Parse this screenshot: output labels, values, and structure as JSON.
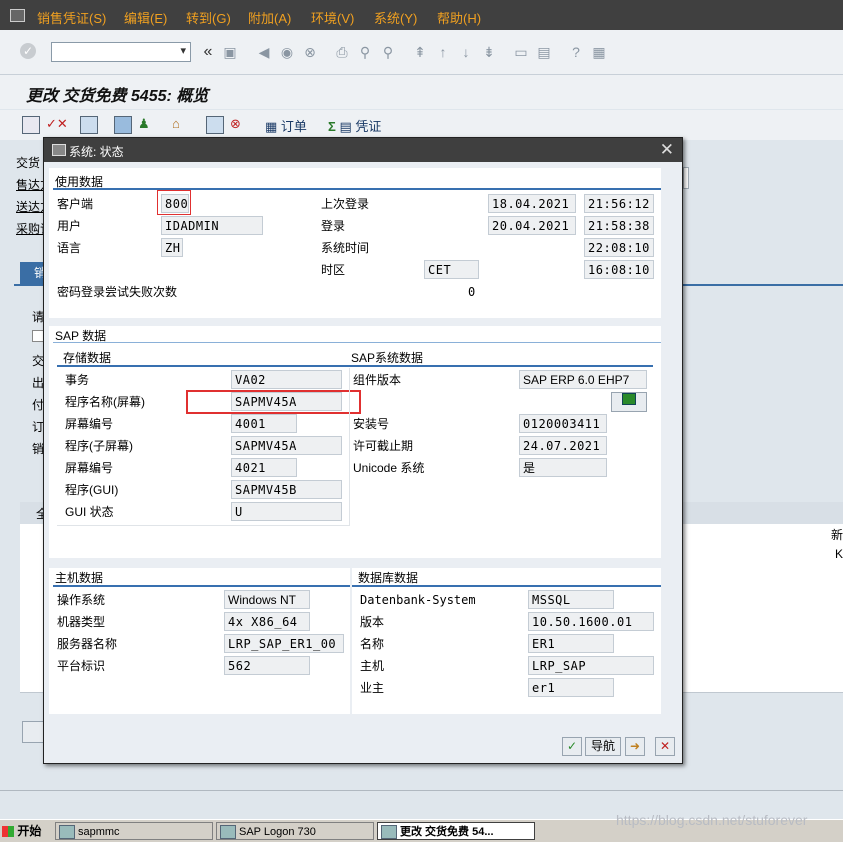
{
  "menu": {
    "items": [
      "销售凭证(S)",
      "编辑(E)",
      "转到(G)",
      "附加(A)",
      "环境(V)",
      "系统(Y)",
      "帮助(H)"
    ]
  },
  "toolbar": {
    "command_field": ""
  },
  "page": {
    "title": "更改 交货免费 5455: 概览"
  },
  "app_toolbar": {
    "order_label": "订单",
    "document_label": "凭证"
  },
  "background": {
    "labels": [
      "交货",
      "售达方",
      "送达方",
      "采购订"
    ],
    "tab_label": "销",
    "left_labels": [
      "请",
      "交",
      "出",
      "付",
      "订",
      "销"
    ],
    "table_header_left": "全",
    "right_fragment_1": "新",
    "right_fragment_2": "K"
  },
  "dialog": {
    "title": "系统: 状态",
    "usage": {
      "header": "使用数据",
      "client_label": "客户端",
      "client_value": "800",
      "user_label": "用户",
      "user_value": "IDADMIN",
      "language_label": "语言",
      "language_value": "ZH",
      "last_logon_label": "上次登录",
      "last_logon_date": "18.04.2021",
      "last_logon_time": "21:56:12",
      "logon_label": "登录",
      "logon_date": "20.04.2021",
      "logon_time": "21:58:38",
      "system_time_label": "系统时间",
      "system_time_value": "22:08:10",
      "timezone_label": "时区",
      "timezone_value": "CET",
      "timezone_time": "16:08:10",
      "failed_logon_label": "密码登录尝试失败次数",
      "failed_logon_value": "0"
    },
    "sap_data": {
      "header": "SAP 数据",
      "repository_header": "存储数据",
      "transaction_label": "事务",
      "transaction_value": "VA02",
      "program_screen_label": "程序名称(屏幕)",
      "program_screen_value": "SAPMV45A",
      "screen_number_label": "屏幕编号",
      "screen_number_value": "4001",
      "program_subscreen_label": "程序(子屏幕)",
      "program_subscreen_value": "SAPMV45A",
      "screen_number2_label": "屏幕编号",
      "screen_number2_value": "4021",
      "program_gui_label": "程序(GUI)",
      "program_gui_value": "SAPMV45B",
      "gui_status_label": "GUI 状态",
      "gui_status_value": "U",
      "system_header": "SAP系统数据",
      "component_label": "组件版本",
      "component_value": "SAP ERP 6.0 EHP7",
      "install_label": "安装号",
      "install_value": "0120003411",
      "license_label": "许可截止期",
      "license_value": "24.07.2021",
      "unicode_label": "Unicode 系统",
      "unicode_value": "是"
    },
    "host": {
      "header": "主机数据",
      "os_label": "操作系统",
      "os_value": "Windows NT",
      "machine_label": "机器类型",
      "machine_value": "4x X86_64",
      "server_label": "服务器名称",
      "server_value": "LRP_SAP_ER1_00",
      "platform_label": "平台标识",
      "platform_value": "562"
    },
    "db": {
      "header": "数据库数据",
      "system_label": "Datenbank-System",
      "system_value": "MSSQL",
      "version_label": "版本",
      "version_value": "10.50.1600.01",
      "name_label": "名称",
      "name_value": "ER1",
      "host_label": "主机",
      "host_value": "LRP_SAP",
      "owner_label": "业主",
      "owner_value": "er1"
    },
    "buttons": {
      "navigate_label": "导航"
    }
  },
  "taskbar": {
    "start_label": "开始",
    "tasks": [
      "sapmmc",
      "SAP Logon 730",
      "更改 交货免费 54..."
    ]
  },
  "watermark": "https://blog.csdn.net/stuforever"
}
